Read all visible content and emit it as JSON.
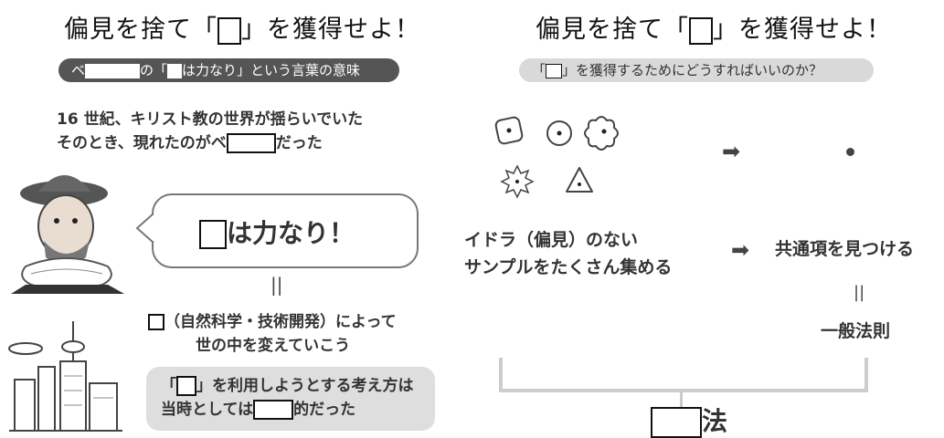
{
  "left": {
    "title": {
      "pre": "偏見を捨て「",
      "post": "」を獲得せよ！"
    },
    "pill": {
      "a": "ベ",
      "b": "の「",
      "c": "は力なり」という言葉の意味"
    },
    "intro_line1": "16 世紀、キリスト教の世界が揺らいでいた",
    "intro_line2_pre": "そのとき、現れたのがベ",
    "intro_line2_post": "だった",
    "bubble_text": "は力なり！",
    "equals": "||",
    "science_line1": "（自然科学・技術開発）によって",
    "science_line2": "世の中を変えていこう",
    "callout_line1_pre": "「",
    "callout_line1_post": "」を利用しようとする考え方は",
    "callout_line2_pre": "当時としては",
    "callout_line2_post": "的だった"
  },
  "right": {
    "title": {
      "pre": "偏見を捨て「",
      "post": "」を獲得せよ！"
    },
    "pill": {
      "a": "「",
      "b": "」を獲得するためにどうすればいいのか？"
    },
    "idola_line1": "イドラ（偏見）のない",
    "idola_line2": "サンプルをたくさん集める",
    "common": "共通項を見つける",
    "equals": "||",
    "general_law": "一般法則",
    "method_suffix": "法",
    "arrow_glyph": "➡"
  }
}
